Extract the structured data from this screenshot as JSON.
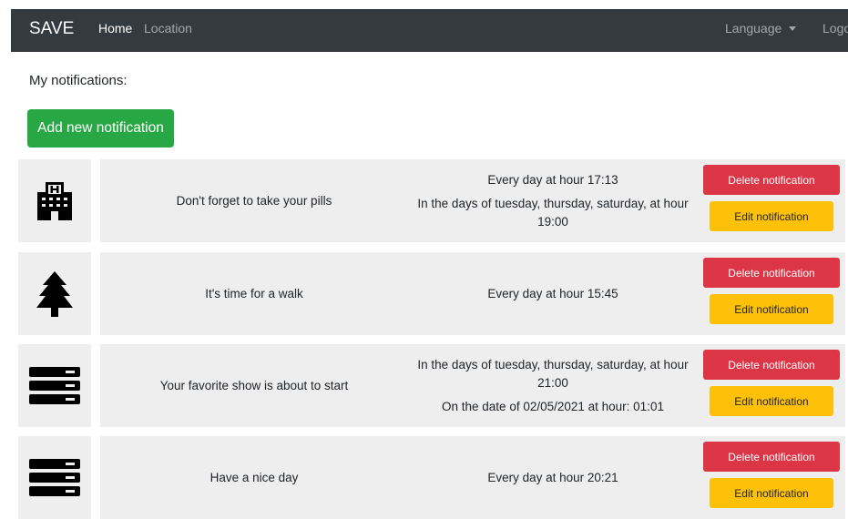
{
  "navbar": {
    "brand": "SAVE",
    "links": [
      "Home",
      "Location"
    ],
    "language_label": "Language",
    "logout_label": "Logout"
  },
  "page": {
    "heading": "My notifications:",
    "add_button_label": "Add new notification"
  },
  "notifications": [
    {
      "icon": "hospital-icon",
      "message": "Don't forget to take your pills",
      "schedule": [
        "Every day at hour 17:13",
        "In the days of tuesday, thursday, saturday, at hour 19:00"
      ],
      "delete_label": "Delete notification",
      "edit_label": "Edit notification"
    },
    {
      "icon": "tree-icon",
      "message": "It's time for a walk",
      "schedule": [
        "Every day at hour 15:45"
      ],
      "delete_label": "Delete notification",
      "edit_label": "Edit notification"
    },
    {
      "icon": "server-icon",
      "message": "Your favorite show is about to start",
      "schedule": [
        "In the days of tuesday, thursday, saturday, at hour 21:00",
        "On the date of 02/05/2021 at hour: 01:01"
      ],
      "delete_label": "Delete notification",
      "edit_label": "Edit notification"
    },
    {
      "icon": "server-icon",
      "message": "Have a nice day",
      "schedule": [
        "Every day at hour 20:21"
      ],
      "delete_label": "Delete notification",
      "edit_label": "Edit notification"
    }
  ],
  "colors": {
    "navbar_bg": "#343a40",
    "add_button": "#28a745",
    "delete_button": "#dc3545",
    "edit_button": "#ffc107",
    "card_bg": "#eeeeee"
  }
}
